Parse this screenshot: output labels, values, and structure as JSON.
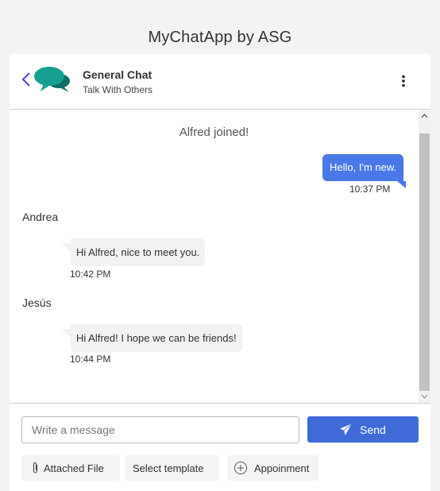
{
  "app": {
    "title": "MyChatApp by ASG"
  },
  "chat": {
    "name": "General Chat",
    "subtitle": "Talk With Others"
  },
  "messages": {
    "system": "Alfred joined!",
    "outgoing": {
      "text": "Hello, I'm new.",
      "time": "10:37 PM"
    },
    "incoming": [
      {
        "sender": "Andrea",
        "text": "Hi Alfred, nice to meet you.",
        "time": "10:42 PM"
      },
      {
        "sender": "Jesús",
        "text": "Hi Alfred! I hope we can be friends!",
        "time": "10:44 PM"
      }
    ]
  },
  "composer": {
    "placeholder": "Write a message",
    "value": "",
    "send_label": "Send"
  },
  "tools": {
    "attach_label": "Attached File",
    "template_label": "Select template",
    "appointment_label": "Appoinment"
  },
  "icons": {
    "back": "chevron-left-icon",
    "logo": "chat-bubbles-icon",
    "menu": "more-vertical-icon",
    "send": "paper-plane-icon",
    "attach": "paperclip-icon",
    "appointment": "plus-circle-icon"
  },
  "colors": {
    "accent": "#3f6ad8",
    "outgoing_bubble": "#4a78e8",
    "logo_teal": "#17a091",
    "logo_dark": "#0e6e63",
    "back_purple": "#5b3fd1"
  }
}
